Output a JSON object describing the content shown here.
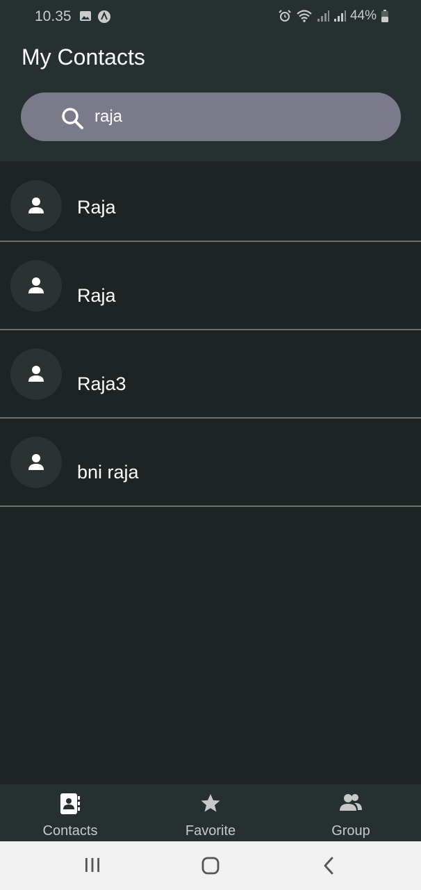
{
  "status_bar": {
    "time": "10.35",
    "battery": "44%",
    "left_icons": [
      "image-icon",
      "app-icon"
    ],
    "right_icons": [
      "alarm-icon",
      "wifi-icon",
      "signal-icon",
      "signal-icon",
      "battery-icon"
    ]
  },
  "app": {
    "title": "My Contacts"
  },
  "search": {
    "value": "raja",
    "icon": "search-icon"
  },
  "contacts": [
    {
      "name": "Raja"
    },
    {
      "name": "Raja"
    },
    {
      "name": "Raja3"
    },
    {
      "name": "bni raja"
    }
  ],
  "bottom_nav": {
    "items": [
      {
        "label": "Contacts",
        "icon": "contact-book-icon"
      },
      {
        "label": "Favorite",
        "icon": "star-icon"
      },
      {
        "label": "Group",
        "icon": "group-icon"
      }
    ]
  },
  "system_nav": [
    "recents-icon",
    "home-icon",
    "back-icon"
  ],
  "colors": {
    "header": "#273030",
    "background": "#1e2423",
    "search_bg": "#7a7a8a",
    "divider": "#6d7271"
  }
}
